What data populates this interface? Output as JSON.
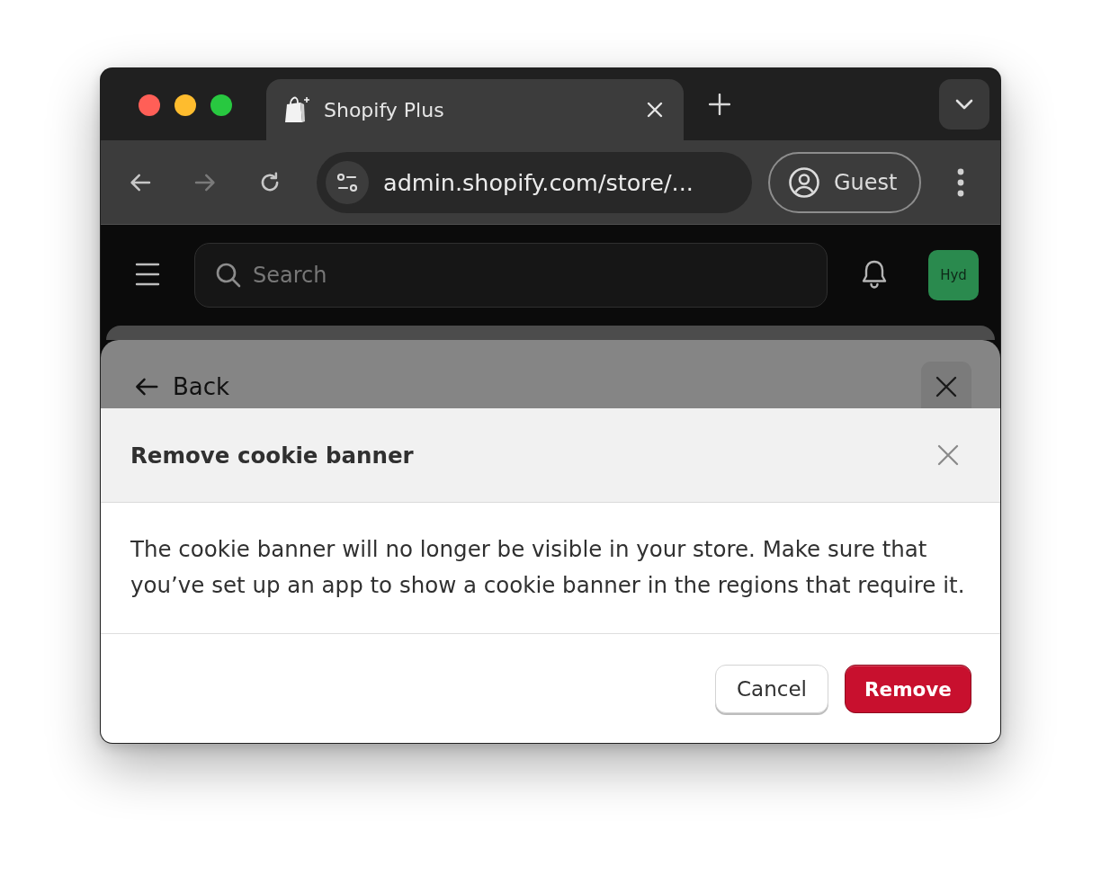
{
  "tabs": [
    {
      "title": "Shopify Plus",
      "selected": true
    }
  ],
  "navigation": [
    {
      "kind": "back",
      "disabled": false
    },
    {
      "kind": "forward",
      "disabled": true
    },
    {
      "kind": "reload",
      "disabled": false
    }
  ],
  "address_bar": {
    "url": "admin.shopify.com/store/..."
  },
  "profile": {
    "label": "Guest"
  },
  "admin_bar": {
    "search": {
      "placeholder": "Search"
    },
    "avatar": {
      "initials": "Hyd"
    }
  },
  "sheet": {
    "back_label": "Back"
  },
  "dialog": {
    "title": "Remove cookie banner",
    "message": "The cookie banner will no longer be visible in your store. Make sure that you’ve set up an app to show a cookie banner in the regions that require it.",
    "buttons": [
      {
        "label": "Cancel",
        "kind": "secondary"
      },
      {
        "label": "Remove",
        "kind": "critical"
      }
    ]
  }
}
